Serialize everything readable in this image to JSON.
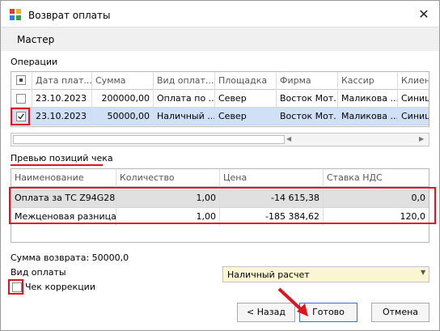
{
  "window": {
    "title": "Возврат оплаты",
    "header": "Мастер"
  },
  "operations": {
    "label": "Операции",
    "columns": [
      "Дата плат...",
      "Сумма",
      "Вид оплат...",
      "Площадка",
      "Фирма",
      "Кассир",
      "Клиент"
    ],
    "rows": [
      {
        "checked": false,
        "cells": [
          "23.10.2023",
          "200000,00",
          "Оплата по ...",
          "Север",
          "Восток Мот...",
          "Маликова ...",
          "Синици"
        ]
      },
      {
        "checked": true,
        "cells": [
          "23.10.2023",
          "50000,00",
          "Наличный ...",
          "Север",
          "Восток Мот...",
          "Маликова ...",
          "Синици"
        ]
      }
    ]
  },
  "preview": {
    "label": "Превью позиций чека",
    "columns": [
      "Наименование",
      "Количество",
      "Цена",
      "Ставка НДС"
    ],
    "rows": [
      [
        "Оплата за ТС Z94G28...",
        "1,00",
        "-14 615,38",
        "0,0"
      ],
      [
        "Межценовая разница",
        "1,00",
        "-185 384,62",
        "120,0"
      ]
    ]
  },
  "refund_sum": "Сумма возврата: 50000,0",
  "payment_type": {
    "label": "Вид оплаты",
    "value": "Наличный расчет"
  },
  "correction": {
    "label": "Чек коррекции",
    "checked": false
  },
  "buttons": {
    "back": "< Назад",
    "done": "Готово",
    "cancel": "Отмена"
  },
  "colors": {
    "highlight": "#e0141e",
    "selected_row": "#cfe0f7",
    "combo_bg": "#fbf6d2"
  },
  "icons": {
    "app": "app-icon",
    "close": "close-icon"
  }
}
